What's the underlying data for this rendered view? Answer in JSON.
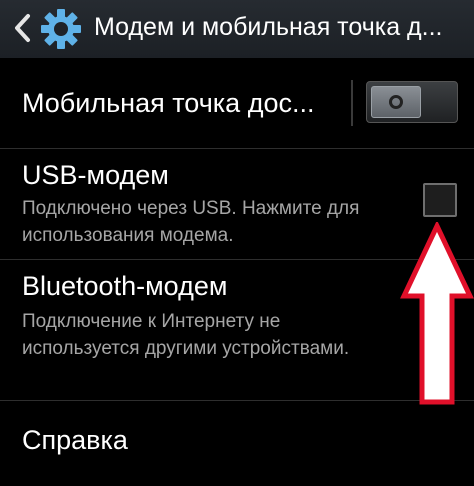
{
  "header": {
    "title": "Модем и мобильная точка д...",
    "back_icon": "chevron-left-icon",
    "app_icon": "gear-icon"
  },
  "hotspot": {
    "label": "Мобильная точка дос...",
    "toggle_state": "off"
  },
  "usb_tethering": {
    "title": "USB-модем",
    "summary": "Подключено через USB. Нажмите для использования модема.",
    "checked": false
  },
  "bluetooth_tethering": {
    "title": "Bluetooth-модем",
    "summary": "Подключение к Интернету не используется другими устройствами."
  },
  "help": {
    "title": "Справка"
  },
  "colors": {
    "background": "#000000",
    "action_bar": "#22272c",
    "accent_icon": "#5fb2e8",
    "summary_text": "#a6a6a6",
    "annotation_arrow": "#e0102a"
  }
}
